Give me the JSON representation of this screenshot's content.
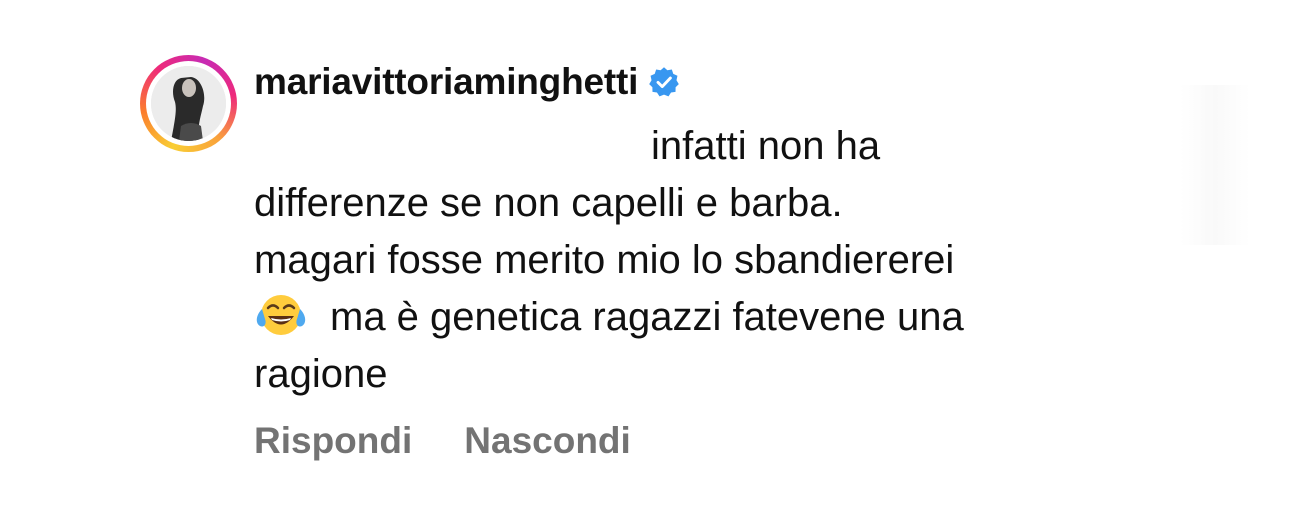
{
  "comment": {
    "author": "mariavittoriaminghetti",
    "verified": true,
    "lines": [
      "infatti non ha",
      "differenze se non capelli e barba.",
      "magari fosse merito mio lo sbandiererei",
      "ma è genetica ragazzi fatevene una",
      "ragione"
    ],
    "emoji": "face-with-tears-of-joy-icon"
  },
  "actions": {
    "reply_label": "Rispondi",
    "hide_label": "Nascondi"
  },
  "colors": {
    "verified_badge": "#3897f0",
    "action_text": "#737373"
  }
}
